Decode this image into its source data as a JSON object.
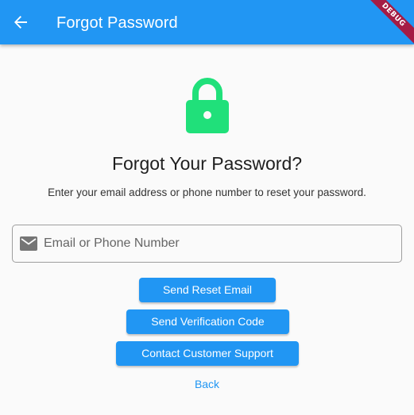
{
  "appbar": {
    "title": "Forgot Password",
    "back_icon": "arrow-back-icon",
    "color": "#2196f3"
  },
  "debug_banner": {
    "label": "DEBUG",
    "color": "#a51c45"
  },
  "hero": {
    "icon": "lock-icon",
    "icon_color": "#20e07a"
  },
  "heading": "Forgot Your Password?",
  "subtext": "Enter your email address or phone number to reset your password.",
  "input": {
    "icon": "mail-icon",
    "placeholder": "Email or Phone Number",
    "value": ""
  },
  "buttons": {
    "send_reset_email": "Send Reset Email",
    "send_verification_code": "Send Verification Code",
    "contact_support": "Contact Customer Support",
    "back": "Back"
  },
  "colors": {
    "primary": "#2196f3",
    "background": "#fafafa"
  }
}
